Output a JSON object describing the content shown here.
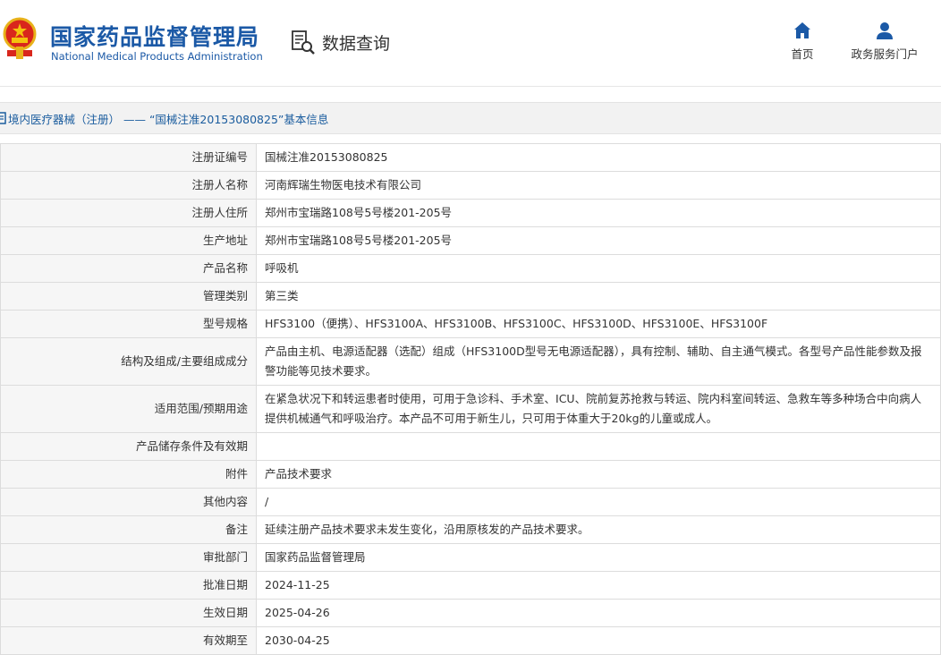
{
  "header": {
    "logo_cn": "国家药品监督管理局",
    "logo_en": "National Medical Products Administration",
    "query_label": "数据查询",
    "nav": [
      {
        "label": "首页",
        "icon": "home-icon"
      },
      {
        "label": "政务服务门户",
        "icon": "user-icon"
      }
    ]
  },
  "title_bar": {
    "text": "境内医疗器械（注册） —— “国械注准20153080825”基本信息"
  },
  "rows": [
    {
      "label": "注册证编号",
      "value": "国械注准20153080825"
    },
    {
      "label": "注册人名称",
      "value": "河南辉瑞生物医电技术有限公司"
    },
    {
      "label": "注册人住所",
      "value": "郑州市宝瑞路108号5号楼201-205号"
    },
    {
      "label": "生产地址",
      "value": "郑州市宝瑞路108号5号楼201-205号"
    },
    {
      "label": "产品名称",
      "value": "呼吸机"
    },
    {
      "label": "管理类别",
      "value": "第三类"
    },
    {
      "label": "型号规格",
      "value": "HFS3100（便携）、HFS3100A、HFS3100B、HFS3100C、HFS3100D、HFS3100E、HFS3100F"
    },
    {
      "label": "结构及组成/主要组成成分",
      "value": "产品由主机、电源适配器（选配）组成（HFS3100D型号无电源适配器），具有控制、辅助、自主通气模式。各型号产品性能参数及报警功能等见技术要求。"
    },
    {
      "label": "适用范围/预期用途",
      "value": "在紧急状况下和转运患者时使用，可用于急诊科、手术室、ICU、院前复苏抢救与转运、院内科室间转运、急救车等多种场合中向病人提供机械通气和呼吸治疗。本产品不可用于新生儿，只可用于体重大于20kg的儿童或成人。"
    },
    {
      "label": "产品储存条件及有效期",
      "value": ""
    },
    {
      "label": "附件",
      "value": "产品技术要求"
    },
    {
      "label": "其他内容",
      "value": "/"
    },
    {
      "label": "备注",
      "value": "延续注册产品技术要求未发生变化，沿用原核发的产品技术要求。"
    },
    {
      "label": "审批部门",
      "value": "国家药品监督管理局"
    },
    {
      "label": "批准日期",
      "value": "2024-11-25"
    },
    {
      "label": "生效日期",
      "value": "2025-04-26"
    },
    {
      "label": "有效期至",
      "value": "2030-04-25"
    }
  ]
}
